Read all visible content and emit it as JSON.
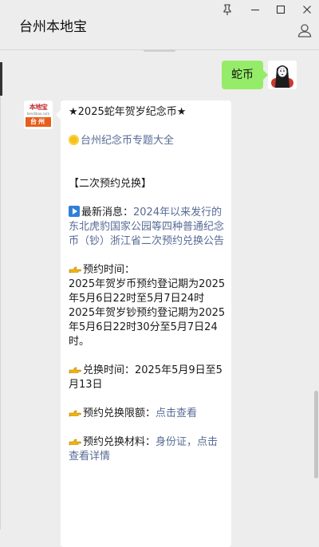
{
  "window": {
    "title": "台州本地宝",
    "controls": {
      "pin": "pin-icon",
      "minimize": "minimize-icon",
      "maximize": "maximize-icon",
      "close": "close-icon"
    }
  },
  "messages": {
    "outgoing": {
      "text": "蛇币"
    },
    "incoming": {
      "account_logo": {
        "top": "本地宝",
        "url": "bendibao.com",
        "city": "台州"
      },
      "title": "★2025蛇年贺岁纪念币★",
      "topic_link": "台州纪念币专题大全",
      "section": "【二次预约兑换】",
      "news_prefix": "最新消息：",
      "news_link": "2024年以来发行的东北虎豹国家公园等四种普通纪念币（钞）浙江省二次预约兑换公告",
      "time_label": "预约时间：",
      "time_line1": "2025年贺岁币预约登记期为2025年5月6日22时至5月7日24时",
      "time_line2": "2025年贺岁钞预约登记期为2025年5月6日22时30分至5月7日24时。",
      "exchange_time": "兑换时间：2025年5月9日至5月13日",
      "limit_label": "预约兑换限额：",
      "limit_link": "点击查看",
      "material_label": "预约兑换材料：",
      "material_link": "身份证，点击查看详情"
    }
  },
  "colors": {
    "outgoing_bubble": "#95ec69",
    "link": "#576b95",
    "background": "#ededed"
  }
}
